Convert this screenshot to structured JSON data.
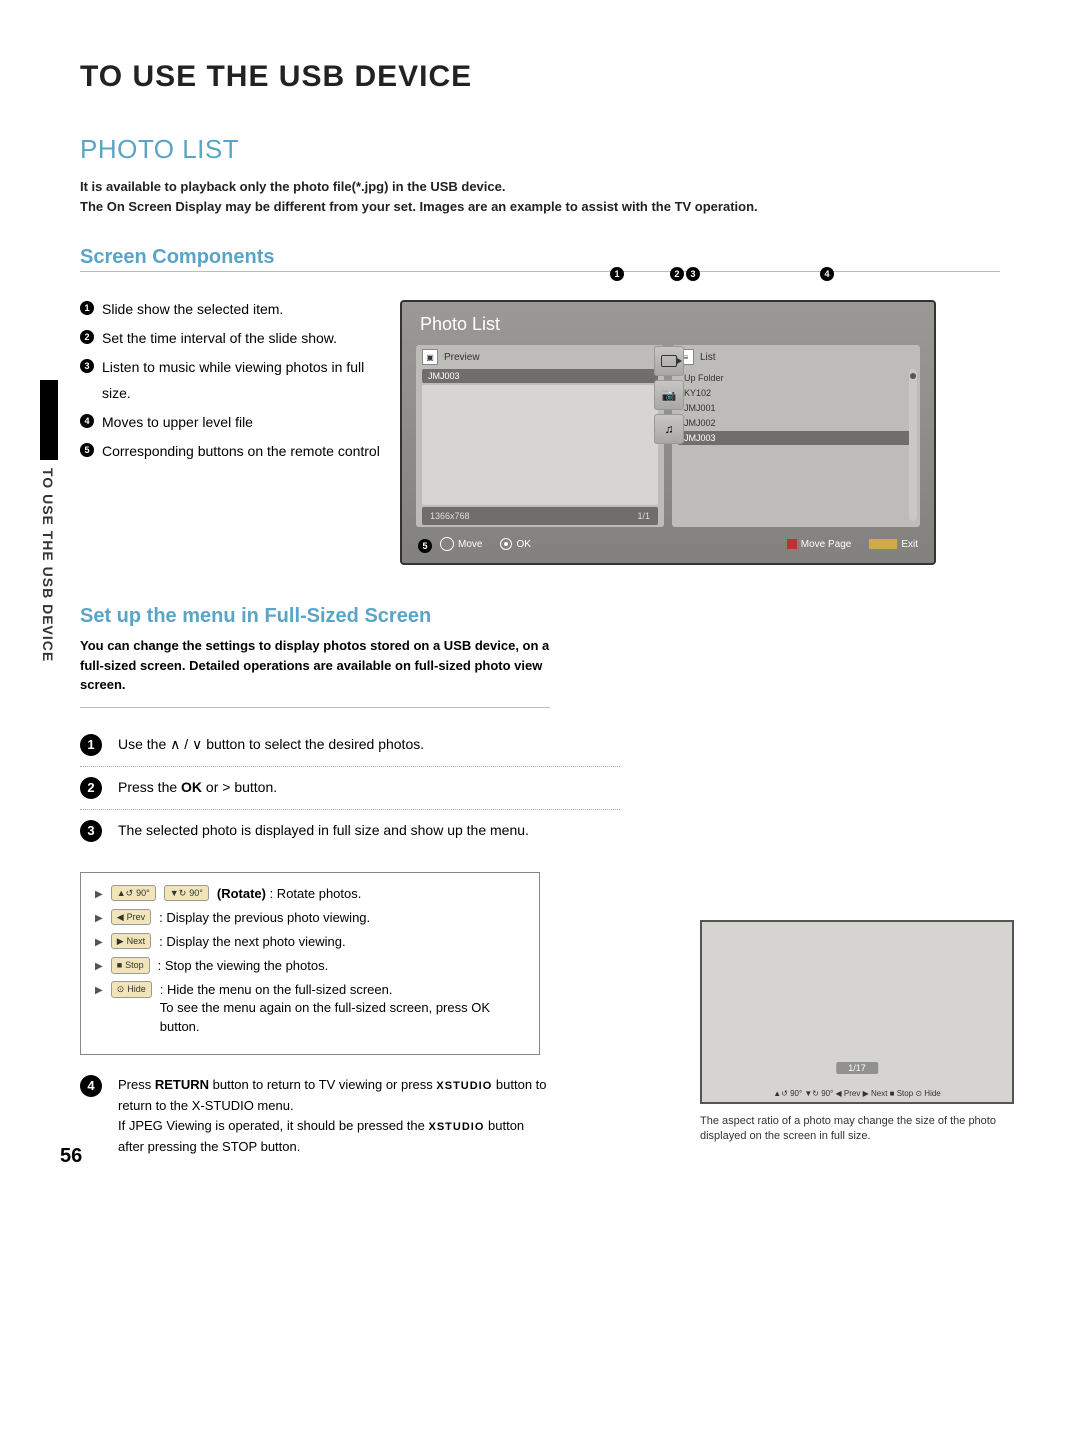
{
  "title": "TO USE THE USB DEVICE",
  "section1": "PHOTO LIST",
  "intro1": "It is available to playback only the photo file(*.jpg) in the USB device.",
  "intro2": "The On Screen Display may be different from your set. Images are an example to assist with the TV operation.",
  "screen_components": "Screen Components",
  "side_label": "TO USE THE USB DEVICE",
  "components": {
    "1": "Slide show the selected item.",
    "2": "Set the time interval of the slide show.",
    "3": "Listen to music while viewing photos in full size.",
    "4": "Moves to upper level file",
    "5": "Corresponding buttons on the remote control"
  },
  "tv": {
    "title": "Photo List",
    "preview_label": "Preview",
    "preview_name": "JMJ003",
    "preview_res": "1366x768",
    "preview_page": "1/1",
    "list_label": "List",
    "list_items": [
      "Up Folder",
      "KY102",
      "JMJ001",
      "JMJ002",
      "JMJ003"
    ],
    "footer": {
      "move": "Move",
      "ok": "OK",
      "movepage": "Move Page",
      "exit": "Exit"
    }
  },
  "fullsize_title": "Set up the menu in Full-Sized Screen",
  "fullsize_intro": "You can change the settings to display photos stored on a USB device, on a full-sized screen. Detailed operations are available on full-sized photo view screen.",
  "steps": {
    "1a": "Use the ",
    "1b": " button to select the desired photos.",
    "2a": "Press the ",
    "2b": "OK",
    "2c": " or  >  button.",
    "3": "The selected photo is displayed in full size and show up the menu."
  },
  "controls": {
    "rotate_deg": "90°",
    "rotate_label": "(Rotate)",
    "rotate_desc": " : Rotate photos.",
    "prev_btn": "Prev",
    "prev_desc": ": Display the previous photo viewing.",
    "next_btn": "Next",
    "next_desc": ": Display the next photo viewing.",
    "stop_btn": "Stop",
    "stop_desc": ": Stop the viewing the photos.",
    "hide_btn": "Hide",
    "hide_desc": ": Hide the menu on the full-sized screen.",
    "hide_note": "To see the menu again on the full-sized screen, press OK button."
  },
  "step4": {
    "a": "Press ",
    "b": "RETURN",
    "c": " button to return to TV viewing or press ",
    "d": " button to return to the X-STUDIO menu.",
    "e": "If JPEG Viewing is operated, it should be pressed the ",
    "f": " button after pressing the STOP button."
  },
  "photo": {
    "count": "1/17",
    "bar": "▲↺ 90°  ▼↻ 90°  ◀ Prev  ▶ Next  ■ Stop  ⊙ Hide",
    "caption": "The aspect ratio of a photo may change the size of the photo displayed on the screen in full size."
  },
  "page_num": "56",
  "xstudio": "XSTUDIO"
}
